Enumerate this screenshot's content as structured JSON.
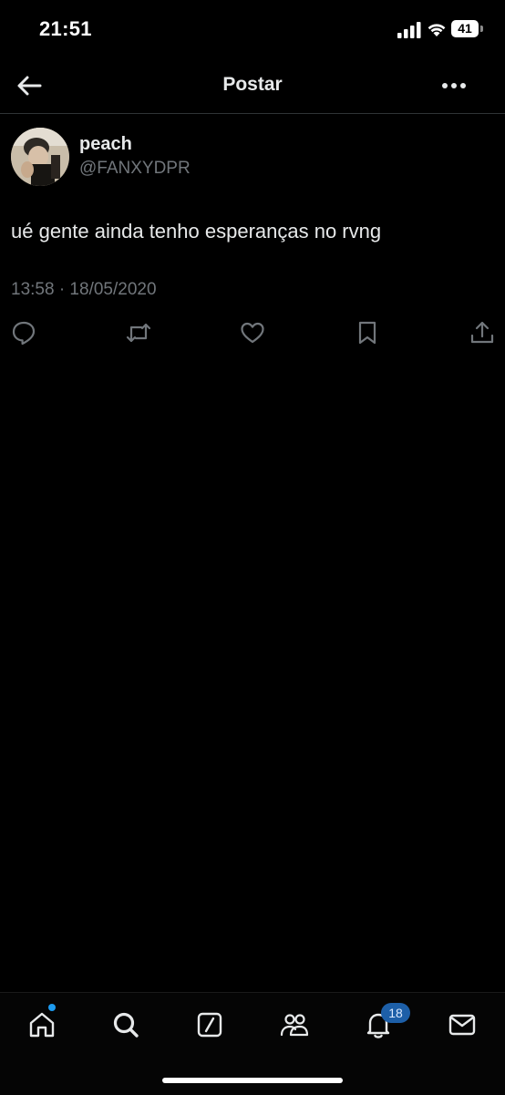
{
  "status_bar": {
    "time": "21:51",
    "battery_level": "41",
    "icons": [
      "signal-icon",
      "wifi-icon",
      "battery-icon"
    ]
  },
  "header": {
    "title": "Postar",
    "back_icon": "arrow-left-icon",
    "more_icon": "more-dots-icon"
  },
  "tweet": {
    "display_name": "peach",
    "handle": "@FANXYDPR",
    "text": "ué gente ainda tenho esperanças no rvng",
    "timestamp": "13:58 · 18/05/2020",
    "actions": [
      "reply-icon",
      "retweet-icon",
      "like-icon",
      "bookmark-icon",
      "share-icon"
    ]
  },
  "bottom_nav": {
    "items": [
      "home-icon",
      "search-icon",
      "grok-icon",
      "communities-icon",
      "notifications-icon",
      "messages-icon"
    ],
    "notifications_badge": "18"
  },
  "colors": {
    "background": "#000000",
    "text_primary": "#e7e9ea",
    "text_secondary": "#71767b",
    "accent": "#1d9bf0",
    "divider": "#2f3336"
  }
}
